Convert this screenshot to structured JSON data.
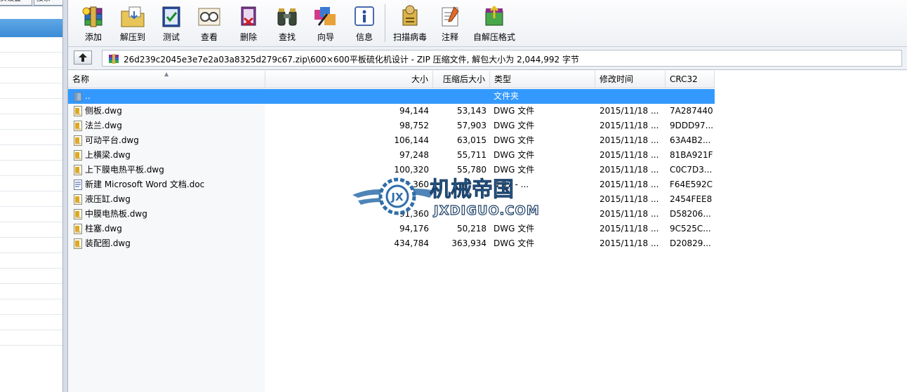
{
  "background_window": {
    "tabs": [
      "页设置",
      "搜索"
    ]
  },
  "toolbar": {
    "buttons": [
      {
        "label": "添加",
        "icon": "add-archive-icon"
      },
      {
        "label": "解压到",
        "icon": "extract-to-icon"
      },
      {
        "label": "测试",
        "icon": "test-icon"
      },
      {
        "label": "查看",
        "icon": "view-icon"
      },
      {
        "label": "删除",
        "icon": "delete-icon"
      },
      {
        "label": "查找",
        "icon": "find-icon"
      },
      {
        "label": "向导",
        "icon": "wizard-icon"
      },
      {
        "label": "信息",
        "icon": "info-icon"
      },
      {
        "label": "扫描病毒",
        "icon": "virus-scan-icon"
      },
      {
        "label": "注释",
        "icon": "comment-icon"
      },
      {
        "label": "自解压格式",
        "icon": "sfx-icon"
      }
    ]
  },
  "address_bar": {
    "path": "26d239c2045e3e7e2a03a8325d279c67.zip\\600×600平板硫化机设计 - ZIP 压缩文件, 解包大小为 2,044,992 字节"
  },
  "columns": {
    "name": "名称",
    "size": "大小",
    "packed": "压缩后大小",
    "type": "类型",
    "modified": "修改时间",
    "crc": "CRC32"
  },
  "files": [
    {
      "name": "..",
      "size": "",
      "packed": "",
      "type": "文件夹",
      "modified": "",
      "crc": "",
      "icon": "folder-up-icon",
      "selected": true
    },
    {
      "name": "侧板.dwg",
      "size": "94,144",
      "packed": "53,143",
      "type": "DWG 文件",
      "modified": "2015/11/18 ...",
      "crc": "7A287440",
      "icon": "dwg-file-icon"
    },
    {
      "name": "法兰.dwg",
      "size": "98,752",
      "packed": "57,903",
      "type": "DWG 文件",
      "modified": "2015/11/18 ...",
      "crc": "9DDD97...",
      "icon": "dwg-file-icon"
    },
    {
      "name": "可动平台.dwg",
      "size": "106,144",
      "packed": "63,015",
      "type": "DWG 文件",
      "modified": "2015/11/18 ...",
      "crc": "63A4B2...",
      "icon": "dwg-file-icon"
    },
    {
      "name": "上横梁.dwg",
      "size": "97,248",
      "packed": "55,711",
      "type": "DWG 文件",
      "modified": "2015/11/18 ...",
      "crc": "81BA921F",
      "icon": "dwg-file-icon"
    },
    {
      "name": "上下膜电热平板.dwg",
      "size": "100,320",
      "packed": "55,780",
      "type": "DWG 文件",
      "modified": "2015/11/18 ...",
      "crc": "C0C7D3...",
      "icon": "dwg-file-icon"
    },
    {
      "name": "新建 Microsoft Word 文档.doc",
      "size": "3,360",
      "packed": "",
      "type": "d 97 - ...",
      "modified": "2015/11/18 ...",
      "crc": "F64E592C",
      "icon": "doc-file-icon"
    },
    {
      "name": "液压缸.dwg",
      "size": "",
      "packed": "",
      "type": "",
      "modified": "2015/11/18 ...",
      "crc": "2454FEE8",
      "icon": "dwg-file-icon"
    },
    {
      "name": "中膜电热板.dwg",
      "size": "91,360",
      "packed": "",
      "type": "",
      "modified": "2015/11/18 ...",
      "crc": "D58206...",
      "icon": "dwg-file-icon"
    },
    {
      "name": "柱塞.dwg",
      "size": "94,176",
      "packed": "50,218",
      "type": "DWG 文件",
      "modified": "2015/11/18 ...",
      "crc": "9C525C...",
      "icon": "dwg-file-icon"
    },
    {
      "name": "装配图.dwg",
      "size": "434,784",
      "packed": "363,934",
      "type": "DWG 文件",
      "modified": "2015/11/18 ...",
      "crc": "D20829...",
      "icon": "dwg-file-icon"
    }
  ],
  "watermark": {
    "title": "机械帝国",
    "url": "JXDIGUO.COM",
    "badge": "JX"
  },
  "colors": {
    "selection": "#3399ff",
    "watermark_blue": "#2f6ea9"
  }
}
